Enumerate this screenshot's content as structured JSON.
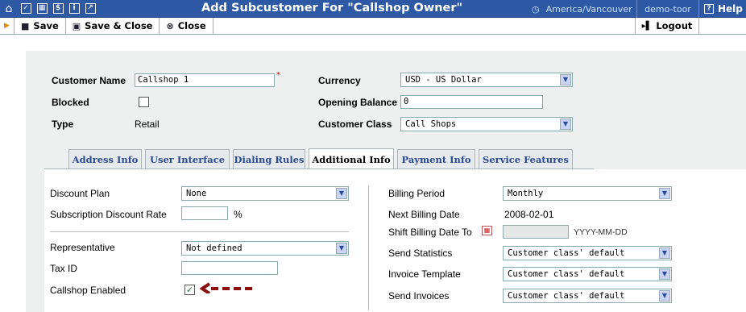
{
  "window": {
    "title": "Add Subcustomer For \"Callshop Owner\"",
    "timezone": "America/Vancouver",
    "user": "demo-toor",
    "help": "Help"
  },
  "toolbar": {
    "save": "Save",
    "save_close": "Save & Close",
    "close": "Close",
    "logout": "Logout"
  },
  "customer": {
    "name_label": "Customer Name",
    "name_value": "Callshop 1",
    "blocked_label": "Blocked",
    "type_label": "Type",
    "type_value": "Retail",
    "currency_label": "Currency",
    "currency_value": "USD - US Dollar",
    "opening_balance_label": "Opening Balance",
    "opening_balance_value": "0",
    "customer_class_label": "Customer Class",
    "customer_class_value": "Call Shops"
  },
  "tabs": [
    {
      "label": "Address Info"
    },
    {
      "label": "User Interface"
    },
    {
      "label": "Dialing Rules"
    },
    {
      "label": "Additional Info"
    },
    {
      "label": "Payment Info"
    },
    {
      "label": "Service Features"
    }
  ],
  "left": {
    "discount_plan_label": "Discount Plan",
    "discount_plan_value": "None",
    "subscription_discount_label": "Subscription Discount Rate",
    "subscription_discount_value": "",
    "percent": "%",
    "representative_label": "Representative",
    "representative_value": "Not defined",
    "tax_id_label": "Tax ID",
    "tax_id_value": "",
    "callshop_enabled_label": "Callshop Enabled"
  },
  "right": {
    "billing_period_label": "Billing Period",
    "billing_period_value": "Monthly",
    "next_billing_label": "Next Billing Date",
    "next_billing_value": "2008-02-01",
    "shift_billing_label": "Shift Billing Date To",
    "shift_billing_hint": "YYYY-MM-DD",
    "send_statistics_label": "Send Statistics",
    "send_statistics_value": "Customer class' default",
    "invoice_template_label": "Invoice Template",
    "invoice_template_value": "Customer class' default",
    "send_invoices_label": "Send Invoices",
    "send_invoices_value": "Customer class' default"
  },
  "colors": {
    "header": "#2c58a4",
    "panel": "#eef0f0",
    "arrow": "#8b0f0f",
    "tab_text": "#2a4a8e"
  }
}
